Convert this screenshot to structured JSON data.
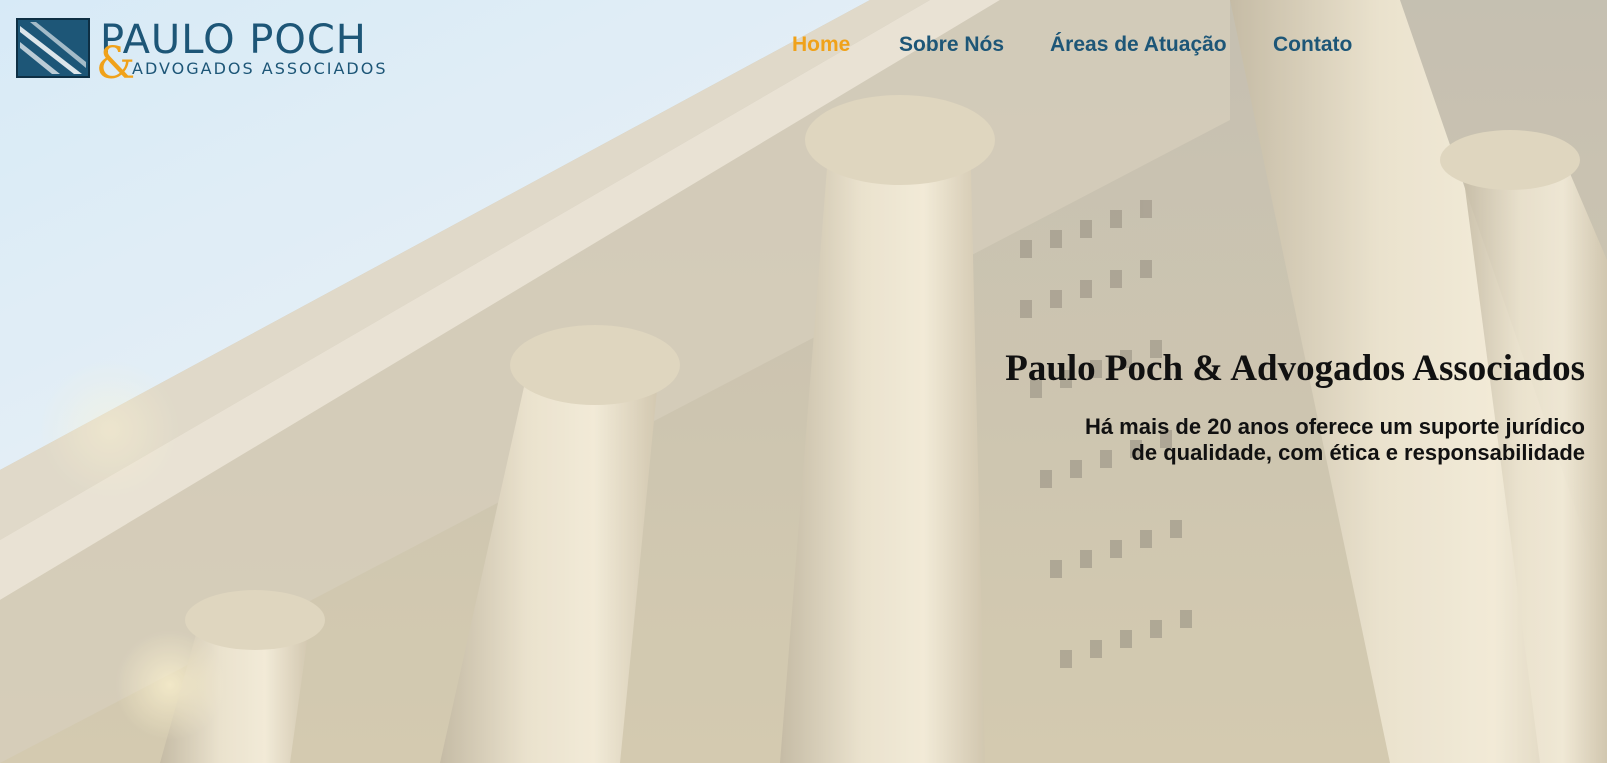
{
  "logo": {
    "main": "PAULO POCH",
    "amp": "&",
    "sub": "ADVOGADOS ASSOCIADOS"
  },
  "nav": {
    "items": [
      {
        "label": "Home",
        "active": true
      },
      {
        "label": "Sobre Nós",
        "active": false
      },
      {
        "label": "Áreas de Atuação",
        "active": false
      },
      {
        "label": "Contato",
        "active": false
      }
    ]
  },
  "hero": {
    "title": "Paulo Poch & Advogados Associados",
    "subtitle_line1": "Há mais de 20 anos oferece um suporte jurídico",
    "subtitle_line2": "de qualidade, com ética e responsabilidade"
  },
  "colors": {
    "brand": "#1d5677",
    "accent": "#f0a21a",
    "text": "#111111"
  }
}
